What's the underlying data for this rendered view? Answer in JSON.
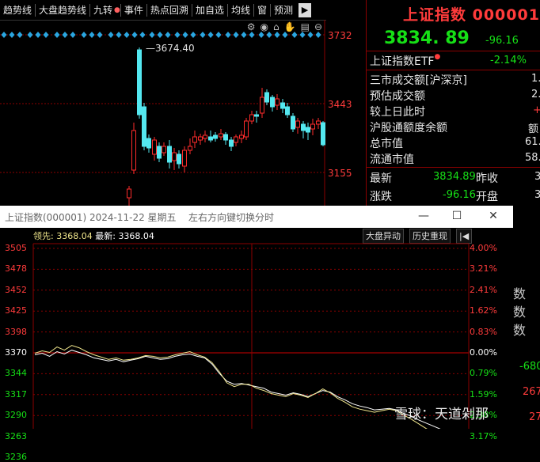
{
  "toolbar": {
    "items": [
      "趋势线",
      "大盘趋势线",
      "九转",
      "事件",
      "热点回溯",
      "加自选",
      "均线",
      "窗",
      "预测"
    ],
    "end_icon": "▶"
  },
  "icons": [
    "settings-icon",
    "eye-icon",
    "basket-icon",
    "hand-icon",
    "print-icon",
    "close-icon"
  ],
  "kline": {
    "y_labels": [
      "3732",
      "3443",
      "3155"
    ],
    "high_label": "3674.40",
    "up_color": "#ff2b2b",
    "down_color": "#54e8f0"
  },
  "quote": {
    "title": "上证指数 000001",
    "price": "3834. 89",
    "change": "-96.16",
    "etf_label": "上证指数ETF",
    "etf_change": "-2.14%",
    "rows": [
      {
        "label": "三市成交额[沪深京]",
        "value": "1."
      },
      {
        "label": "预估成交额",
        "value": "2."
      },
      {
        "label": "较上日此时",
        "value": "+"
      },
      {
        "label": "沪股通额度余额",
        "value": "额"
      },
      {
        "label": "总市值",
        "value": "61."
      },
      {
        "label": "流通市值",
        "value": "58."
      }
    ],
    "latest_label": "最新",
    "latest_value": "3834.89",
    "prev_close_label": "昨收",
    "prev_close_value": "3",
    "change_label": "涨跌",
    "change_value": "-96.16",
    "open_label": "开盘",
    "open_value": "3"
  },
  "popup": {
    "title": "上证指数(000001) 2024-11-22 星期五",
    "hint": "左右方向键切换分时",
    "leader_label": "领先:",
    "leader_value": "3368.04",
    "latest_label": "最新:",
    "latest_value": "3368.04",
    "btn_anomaly": "大盘异动",
    "btn_history": "历史重现",
    "btn_back": "|◀",
    "y_left": [
      "3505",
      "3478",
      "3452",
      "3425",
      "3398",
      "3370",
      "3344",
      "3317",
      "3290",
      "3263",
      "3236"
    ],
    "y_right": [
      "4.00%",
      "3.21%",
      "2.41%",
      "1.62%",
      "0.83%",
      "0.00%",
      "0.79%",
      "1.59%",
      "2.38%",
      "3.17%",
      ""
    ]
  },
  "side_text": {
    "rows": [
      "数",
      "数",
      "数"
    ],
    "v1": "-680",
    "v2": "267",
    "v3": "27"
  },
  "watermark": "雪球：天道剁那",
  "chart_data": {
    "type": "line",
    "title": "上证指数(000001) 2024-11-22 星期五",
    "ylim": [
      3236,
      3505
    ],
    "prev_close": 3370,
    "series": [
      {
        "name": "最新",
        "values": [
          3368,
          3370,
          3366,
          3372,
          3369,
          3374,
          3371,
          3368,
          3364,
          3362,
          3360,
          3362,
          3359,
          3361,
          3363,
          3366,
          3364,
          3362,
          3363,
          3366,
          3368,
          3369,
          3366,
          3364,
          3356,
          3344,
          3334,
          3330,
          3331,
          3329,
          3327,
          3325,
          3320,
          3318,
          3316,
          3319,
          3317,
          3314,
          3318,
          3322,
          3320,
          3314,
          3310,
          3305,
          3302,
          3300,
          3297,
          3298,
          3299,
          3297,
          3292,
          3289,
          3284,
          3280,
          3276,
          3272,
          3269,
          3268
        ]
      },
      {
        "name": "领先",
        "values": [
          3370,
          3373,
          3371,
          3378,
          3374,
          3380,
          3377,
          3372,
          3368,
          3365,
          3362,
          3364,
          3361,
          3362,
          3364,
          3367,
          3366,
          3364,
          3365,
          3368,
          3370,
          3372,
          3368,
          3365,
          3358,
          3346,
          3332,
          3327,
          3330,
          3330,
          3325,
          3322,
          3318,
          3316,
          3314,
          3318,
          3316,
          3313,
          3318,
          3324,
          3319,
          3312,
          3307,
          3301,
          3298,
          3296,
          3294,
          3296,
          3298,
          3296,
          3290,
          3285,
          3279,
          3273,
          3268,
          3267,
          3266,
          3268
        ]
      }
    ]
  }
}
